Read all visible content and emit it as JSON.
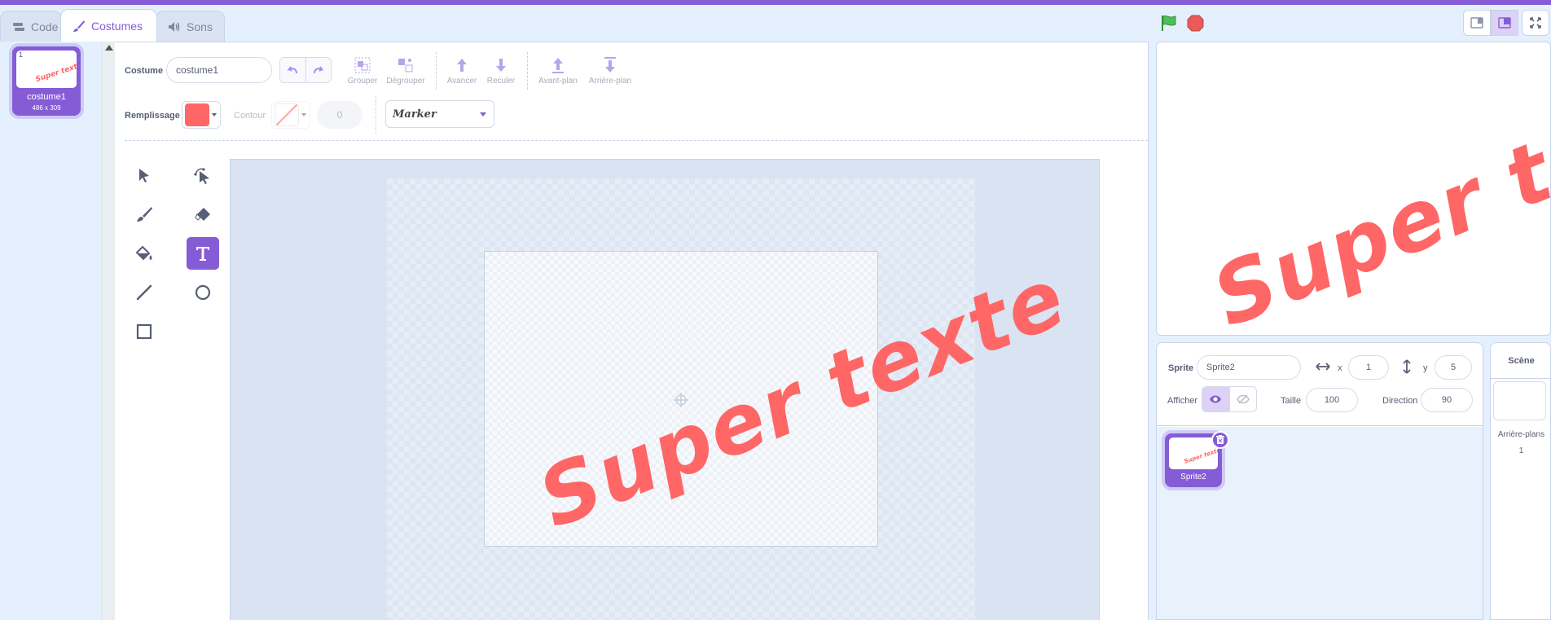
{
  "tabs": [
    {
      "label": "Code",
      "icon": "code-icon"
    },
    {
      "label": "Costumes",
      "icon": "brush-icon"
    },
    {
      "label": "Sons",
      "icon": "speaker-icon"
    }
  ],
  "costumes": [
    {
      "number": "1",
      "name": "costume1",
      "size": "486 x 309",
      "preview_text": "Super texte"
    }
  ],
  "toolbar": {
    "costume_label": "Costume",
    "costume_name": "costume1",
    "group": "Grouper",
    "ungroup": "Dégrouper",
    "forward": "Avancer",
    "backward": "Reculer",
    "front": "Avant-plan",
    "back": "Arrière-plan",
    "fill_label": "Remplissage",
    "fill_color": "#ff6666",
    "outline_label": "Contour",
    "outline_width": "0",
    "font": "Marker"
  },
  "tools": [
    "select-tool",
    "reshape-tool",
    "brush-tool",
    "eraser-tool",
    "fill-tool",
    "text-tool",
    "line-tool",
    "circle-tool",
    "rectangle-tool"
  ],
  "selected_tool": "text-tool",
  "canvas_text": "Super texte",
  "stage_text": "Super texte",
  "sprite_info": {
    "sprite_label": "Sprite",
    "sprite_name": "Sprite2",
    "x_label": "x",
    "x_value": "1",
    "y_label": "y",
    "y_value": "5",
    "show_label": "Afficher",
    "size_label": "Taille",
    "size_value": "100",
    "direction_label": "Direction",
    "direction_value": "90"
  },
  "sprites": [
    {
      "name": "Sprite2",
      "preview_text": "Super texte"
    }
  ],
  "scene": {
    "title": "Scène",
    "backdrops_label": "Arrière-plans",
    "backdrops_count": "1"
  },
  "colors": {
    "accent": "#855cd6",
    "text_color": "#ff6666",
    "background": "#e5f0ff"
  }
}
